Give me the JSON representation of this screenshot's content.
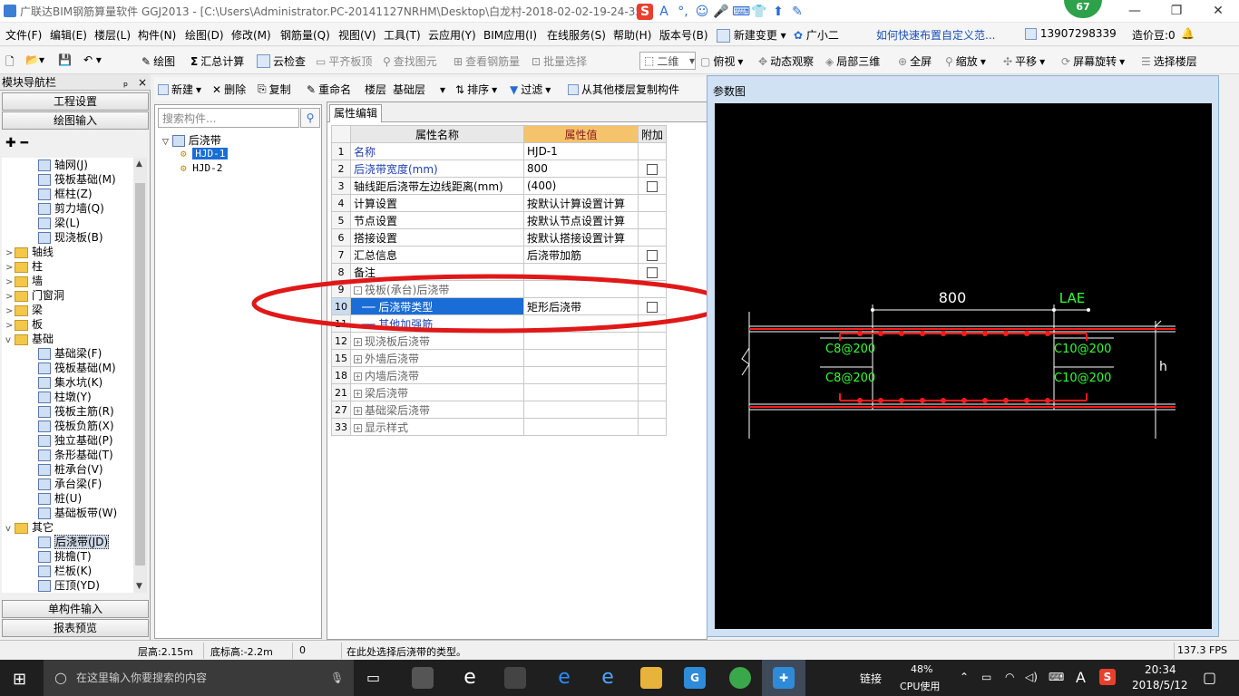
{
  "window": {
    "title": "广联达BIM钢筋算量软件 GGJ2013 - [C:\\Users\\Administrator.PC-20141127NRHM\\Desktop\\白龙村-2018-02-02-19-24-35",
    "badge": "67",
    "minimize": "—",
    "maximize": "❐",
    "close": "✕"
  },
  "ime": [
    "S",
    "A",
    "°,",
    "☺",
    "🎤",
    "⌨",
    "👕",
    "⬆",
    "✎"
  ],
  "menu": [
    "文件(F)",
    "编辑(E)",
    "楼层(L)",
    "构件(N)",
    "绘图(D)",
    "修改(M)",
    "钢筋量(Q)",
    "视图(V)",
    "工具(T)",
    "云应用(Y)",
    "BIM应用(I)",
    "在线服务(S)",
    "帮助(H)",
    "版本号(B)",
    "新建变更",
    "广小二"
  ],
  "menu_right": {
    "tip_link": "如何快速布置自定义范...",
    "phone": "13907298339",
    "price": "造价豆:0"
  },
  "toolbar": {
    "draw": "绘图",
    "sum": "汇总计算",
    "cloud_check": "云检查",
    "flat_slab": "平齐板顶",
    "find": "查找图元",
    "view_rebar": "查看钢筋量",
    "batch": "批量选择",
    "view_mode": "二维",
    "top_view": "俯视",
    "dynamic": "动态观察",
    "local3d": "局部三维",
    "fullscreen": "全屏",
    "zoom": "缩放",
    "pan": "平移",
    "rotate": "屏幕旋转",
    "select_floor": "选择楼层"
  },
  "nav": {
    "header": "模块导航栏",
    "pin": "ₚ",
    "close": "×",
    "btn_project": "工程设置",
    "btn_draw": "绘图输入",
    "btn_single": "单构件输入",
    "btn_report": "报表预览",
    "tree": [
      {
        "label": "轴网(J)",
        "level": 2,
        "kind": "item"
      },
      {
        "label": "筏板基础(M)",
        "level": 2,
        "kind": "item"
      },
      {
        "label": "框柱(Z)",
        "level": 2,
        "kind": "item"
      },
      {
        "label": "剪力墙(Q)",
        "level": 2,
        "kind": "item"
      },
      {
        "label": "梁(L)",
        "level": 2,
        "kind": "item"
      },
      {
        "label": "现浇板(B)",
        "level": 2,
        "kind": "item"
      },
      {
        "label": "轴线",
        "level": 1,
        "kind": "folder",
        "exp": ">"
      },
      {
        "label": "柱",
        "level": 1,
        "kind": "folder",
        "exp": ">"
      },
      {
        "label": "墙",
        "level": 1,
        "kind": "folder",
        "exp": ">"
      },
      {
        "label": "门窗洞",
        "level": 1,
        "kind": "folder",
        "exp": ">"
      },
      {
        "label": "梁",
        "level": 1,
        "kind": "folder",
        "exp": ">"
      },
      {
        "label": "板",
        "level": 1,
        "kind": "folder",
        "exp": ">"
      },
      {
        "label": "基础",
        "level": 1,
        "kind": "folder",
        "exp": "v"
      },
      {
        "label": "基础梁(F)",
        "level": 2,
        "kind": "item"
      },
      {
        "label": "筏板基础(M)",
        "level": 2,
        "kind": "item"
      },
      {
        "label": "集水坑(K)",
        "level": 2,
        "kind": "item"
      },
      {
        "label": "柱墩(Y)",
        "level": 2,
        "kind": "item"
      },
      {
        "label": "筏板主筋(R)",
        "level": 2,
        "kind": "item"
      },
      {
        "label": "筏板负筋(X)",
        "level": 2,
        "kind": "item"
      },
      {
        "label": "独立基础(P)",
        "level": 2,
        "kind": "item"
      },
      {
        "label": "条形基础(T)",
        "level": 2,
        "kind": "item"
      },
      {
        "label": "桩承台(V)",
        "level": 2,
        "kind": "item"
      },
      {
        "label": "承台梁(F)",
        "level": 2,
        "kind": "item"
      },
      {
        "label": "桩(U)",
        "level": 2,
        "kind": "item"
      },
      {
        "label": "基础板带(W)",
        "level": 2,
        "kind": "item"
      },
      {
        "label": "其它",
        "level": 1,
        "kind": "folder",
        "exp": "v"
      },
      {
        "label": "后浇带(JD)",
        "level": 2,
        "kind": "item",
        "selected": true
      },
      {
        "label": "挑檐(T)",
        "level": 2,
        "kind": "item"
      },
      {
        "label": "栏板(K)",
        "level": 2,
        "kind": "item"
      },
      {
        "label": "压顶(YD)",
        "level": 2,
        "kind": "item"
      }
    ]
  },
  "component_toolbar": {
    "new": "新建",
    "delete": "删除",
    "copy": "复制",
    "rename": "重命名",
    "floor": "楼层",
    "floor_value": "基础层",
    "sort": "排序",
    "filter": "过滤",
    "copy_from": "从其他楼层复制构件"
  },
  "component_list": {
    "search_placeholder": "搜索构件...",
    "root": "后浇带",
    "items": [
      "HJD-1",
      "HJD-2"
    ]
  },
  "props": {
    "tab": "属性编辑",
    "header": {
      "name": "属性名称",
      "value": "属性值",
      "extra": "附加"
    },
    "rows": [
      {
        "num": "1",
        "name": "名称",
        "value": "HJD-1",
        "blue": true,
        "check": false
      },
      {
        "num": "2",
        "name": "后浇带宽度(mm)",
        "value": "800",
        "blue": true,
        "check": true
      },
      {
        "num": "3",
        "name": "轴线距后浇带左边线距离(mm)",
        "value": "(400)",
        "blue": false,
        "check": true
      },
      {
        "num": "4",
        "name": "计算设置",
        "value": "按默认计算设置计算",
        "blue": false,
        "check": false
      },
      {
        "num": "5",
        "name": "节点设置",
        "value": "按默认节点设置计算",
        "blue": false,
        "check": false
      },
      {
        "num": "6",
        "name": "搭接设置",
        "value": "按默认搭接设置计算",
        "blue": false,
        "check": false
      },
      {
        "num": "7",
        "name": "汇总信息",
        "value": "后浇带加筋",
        "blue": false,
        "check": true
      },
      {
        "num": "8",
        "name": "备注",
        "value": "",
        "blue": false,
        "check": true
      },
      {
        "num": "9",
        "name": "筏板(承台)后浇带",
        "value": "",
        "group": "-",
        "check": false
      },
      {
        "num": "10",
        "name": "── 后浇带类型",
        "value": "矩形后浇带",
        "selected": true,
        "check": true
      },
      {
        "num": "11",
        "name": "── 其他加强筋",
        "value": "",
        "blue": true,
        "check": false
      },
      {
        "num": "12",
        "name": "现浇板后浇带",
        "value": "",
        "group": "+",
        "check": false
      },
      {
        "num": "15",
        "name": "外墙后浇带",
        "value": "",
        "group": "+",
        "check": false
      },
      {
        "num": "18",
        "name": "内墙后浇带",
        "value": "",
        "group": "+",
        "check": false
      },
      {
        "num": "21",
        "name": "梁后浇带",
        "value": "",
        "group": "+",
        "check": false
      },
      {
        "num": "27",
        "name": "基础梁后浇带",
        "value": "",
        "group": "+",
        "check": false
      },
      {
        "num": "33",
        "name": "显示样式",
        "value": "",
        "group": "+",
        "check": false
      }
    ]
  },
  "diagram": {
    "title": "参数图",
    "width_label": "800",
    "lae_label": "LAE",
    "rebar_tl": "C8@200",
    "rebar_bl": "C8@200",
    "rebar_tr": "C10@200",
    "rebar_br": "C10@200",
    "height_label": "h",
    "colors": {
      "bg": "#000000",
      "line": "#ffffff",
      "rebar": "#ff1a1a",
      "label": "#33ff33"
    }
  },
  "status": {
    "floor_height": "层高:2.15m",
    "bottom_elev": "底标高:-2.2m",
    "zero": "0",
    "hint": "在此处选择后浇带的类型。",
    "fps": "137.3 FPS"
  },
  "taskbar": {
    "search": "在这里输入你要搜索的内容",
    "link": "链接",
    "cpu_pct": "48%",
    "cpu_label": "CPU使用",
    "time": "20:34",
    "date": "2018/5/12",
    "ime": "A"
  },
  "annotation": {
    "color": "#e01818"
  }
}
